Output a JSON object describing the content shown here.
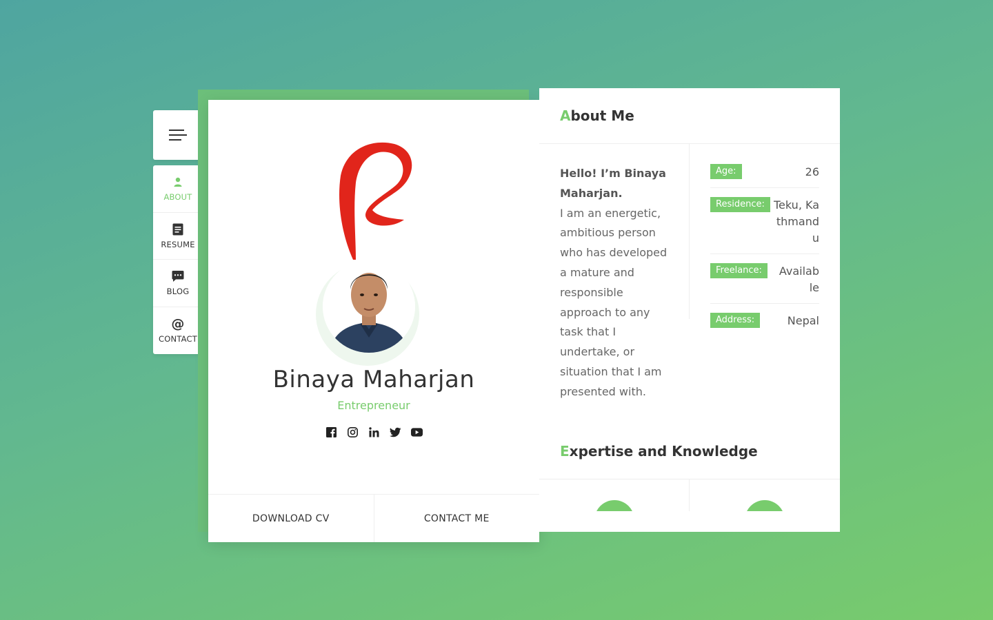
{
  "nav": {
    "items": [
      {
        "label": "ABOUT",
        "icon": "person-icon",
        "active": true
      },
      {
        "label": "RESUME",
        "icon": "document-icon",
        "active": false
      },
      {
        "label": "BLOG",
        "icon": "chat-icon",
        "active": false
      },
      {
        "label": "CONTACT",
        "icon": "at-icon",
        "active": false
      }
    ]
  },
  "profile": {
    "name": "Binaya Maharjan",
    "role": "Entrepreneur",
    "socials": [
      "facebook-icon",
      "instagram-icon",
      "linkedin-icon",
      "twitter-icon",
      "youtube-icon"
    ],
    "download_label": "DOWNLOAD CV",
    "contact_label": "CONTACT ME"
  },
  "about": {
    "title_first": "A",
    "title_rest": "bout Me",
    "greeting": "Hello! I’m Binaya Maharjan.",
    "bio": "I am an energetic, ambitious person who has developed a mature and responsible approach to any task that I undertake, or situation that I am presented with.",
    "info": [
      {
        "label": "Age:",
        "value": "26"
      },
      {
        "label": "Residence:",
        "value": "Teku, Kathmandu"
      },
      {
        "label": "Freelance:",
        "value": "Available"
      },
      {
        "label": "Address:",
        "value": "Nepal"
      }
    ]
  },
  "expertise": {
    "title_first": "E",
    "title_rest": "xpertise and Knowledge"
  },
  "colors": {
    "accent": "#78cc6d",
    "logo_red": "#e1251b"
  }
}
